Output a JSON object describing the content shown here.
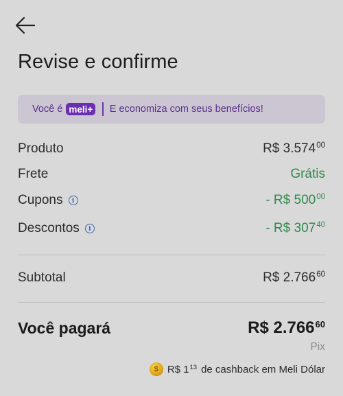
{
  "header": {
    "back_icon": "arrow-left-icon",
    "title": "Revise e confirme"
  },
  "banner": {
    "prefix": "Você é",
    "badge": "meli+",
    "text": "E economiza com seus benefícios!"
  },
  "summary": {
    "produto": {
      "label": "Produto",
      "amount": "R$ 3.574",
      "cents": "00"
    },
    "frete": {
      "label": "Frete",
      "value": "Grátis"
    },
    "cupons": {
      "label": "Cupons",
      "amount": "- R$ 500",
      "cents": "00"
    },
    "descontos": {
      "label": "Descontos",
      "amount": "- R$ 307",
      "cents": "40"
    },
    "subtotal": {
      "label": "Subtotal",
      "amount": "R$ 2.766",
      "cents": "60"
    }
  },
  "total": {
    "label": "Você pagará",
    "amount": "R$ 2.766",
    "cents": "60",
    "method": "Pix"
  },
  "cashback": {
    "icon": "coin-icon",
    "amount": "R$ 1",
    "cents": "13",
    "text": "de cashback em Meli Dólar"
  },
  "colors": {
    "accent_purple": "#6a2fb0",
    "green": "#2f8a4c",
    "info_blue": "#3f64b8"
  }
}
